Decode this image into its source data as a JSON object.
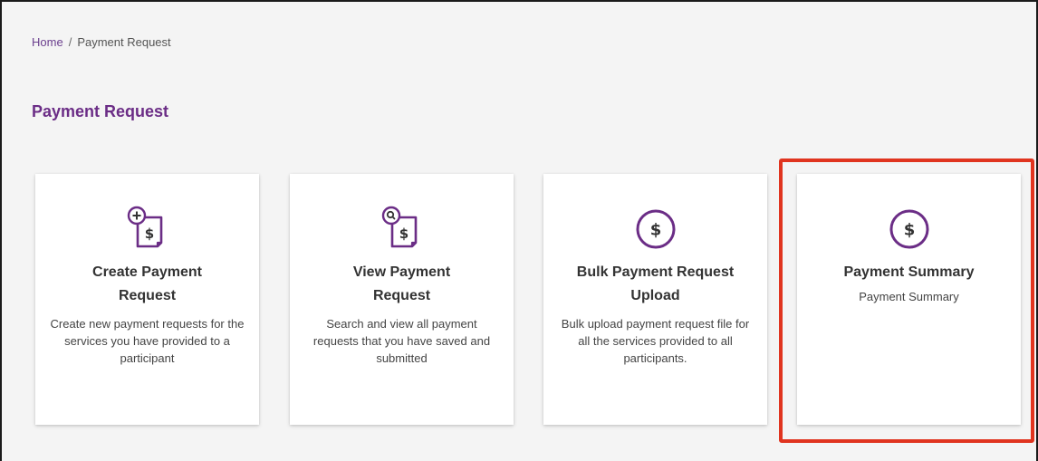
{
  "breadcrumb": {
    "home": "Home",
    "separator": "/",
    "current": "Payment Request"
  },
  "page": {
    "title": "Payment Request"
  },
  "cards": [
    {
      "title_line1": "Create Payment",
      "title_line2": "Request",
      "description": "Create new payment requests for the services you have provided to a participant",
      "icon": "document-add-dollar-icon"
    },
    {
      "title_line1": "View Payment",
      "title_line2": "Request",
      "description": "Search and view all payment requests that you have saved and submitted",
      "icon": "document-search-dollar-icon"
    },
    {
      "title_line1": "Bulk Payment Request",
      "title_line2": "Upload",
      "description": "Bulk upload payment request file for all the services provided to all participants.",
      "icon": "dollar-circle-icon"
    },
    {
      "title_line1": "Payment Summary",
      "title_line2": "",
      "description": "Payment Summary",
      "icon": "dollar-circle-icon"
    }
  ],
  "colors": {
    "accent": "#6b2d86",
    "highlight": "#e0341f"
  }
}
